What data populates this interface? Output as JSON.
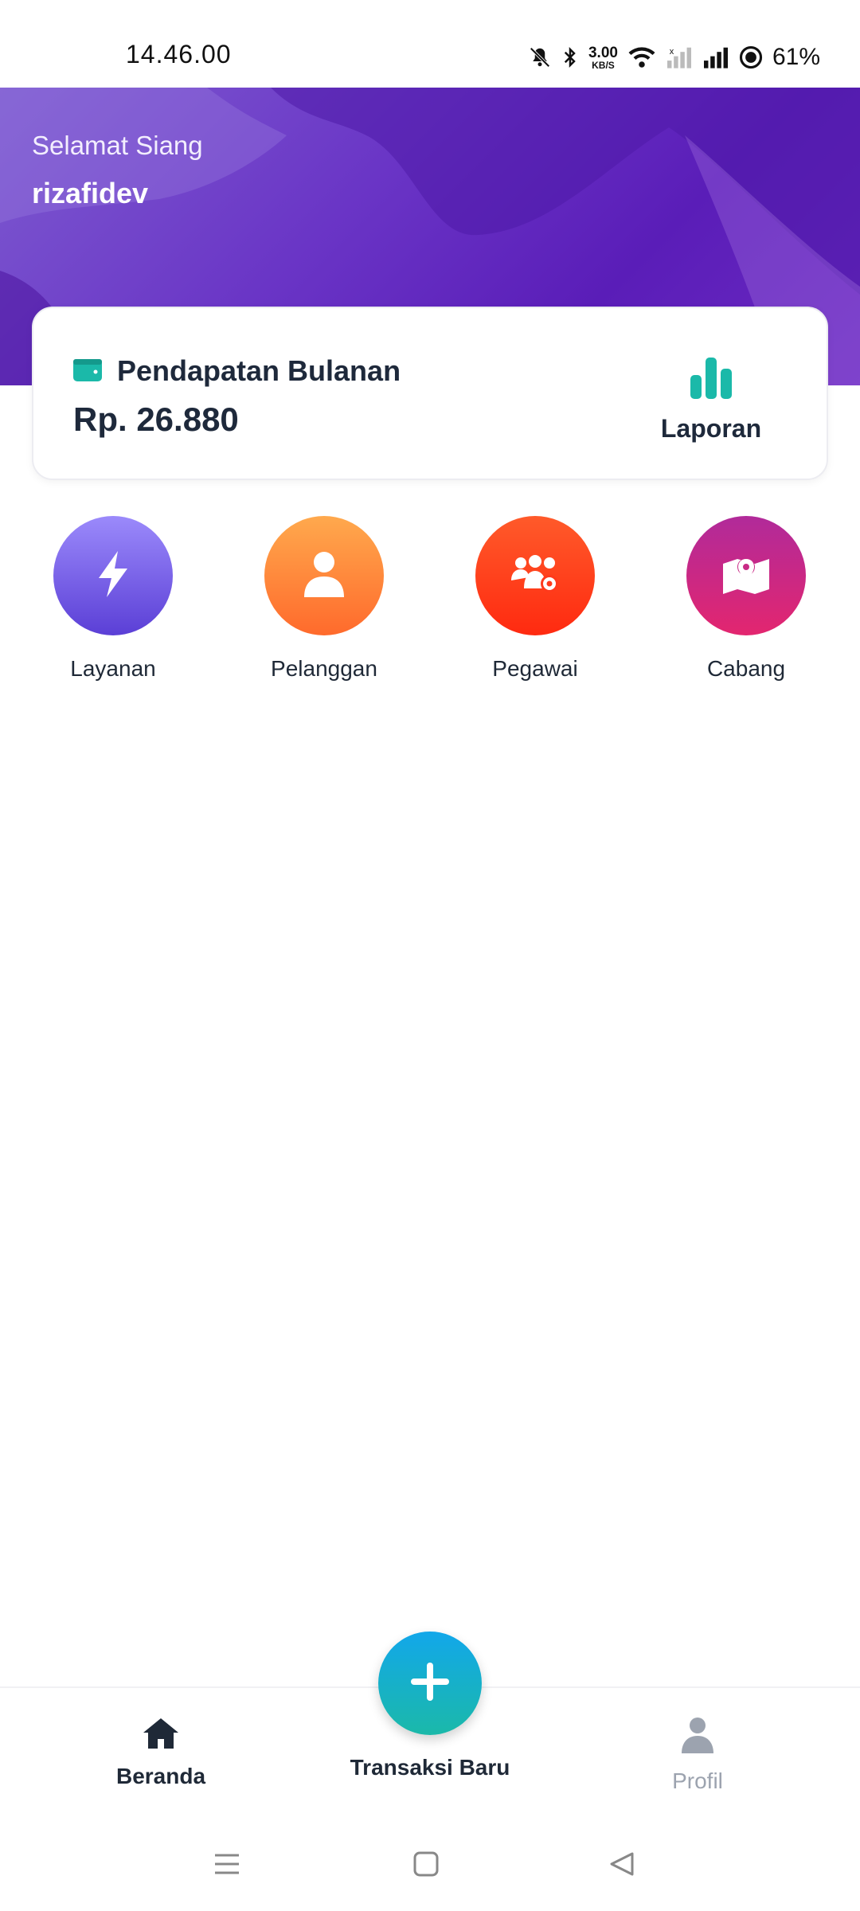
{
  "status_bar": {
    "time": "14.46.00",
    "net_speed_value": "3.00",
    "net_speed_unit": "KB/S",
    "battery": "61%"
  },
  "header": {
    "greeting": "Selamat Siang",
    "username": "rizafidev"
  },
  "income_card": {
    "label": "Pendapatan Bulanan",
    "value": "Rp. 26.880",
    "report_label": "Laporan"
  },
  "menu": {
    "items": [
      {
        "label": "Layanan",
        "icon": "bolt-icon",
        "color": "#6f57e8"
      },
      {
        "label": "Pelanggan",
        "icon": "user-icon",
        "color": "#ff8a3d"
      },
      {
        "label": "Pegawai",
        "icon": "team-gear-icon",
        "color": "#ff3a1c"
      },
      {
        "label": "Cabang",
        "icon": "map-pin-icon",
        "color": "#c92a86"
      }
    ]
  },
  "bottom_nav": {
    "home_label": "Beranda",
    "new_transaction_label": "Transaksi Baru",
    "profile_label": "Profil"
  },
  "colors": {
    "header_purple": "#5a1db8",
    "accent_teal": "#1bb9a9",
    "fab_blue": "#12a7ea"
  }
}
